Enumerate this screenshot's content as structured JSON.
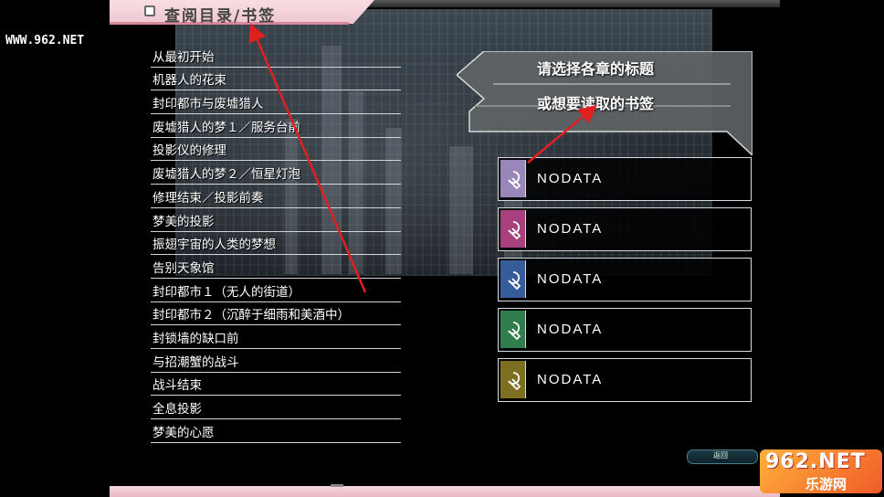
{
  "header": {
    "title": "查阅目录/书签"
  },
  "watermark": {
    "top_left": "WWW.962.NET"
  },
  "chapters": [
    "从最初开始",
    "机器人的花束",
    "封印都市与废墟猎人",
    "废墟猎人的梦１／服务台前",
    "投影仪的修理",
    "废墟猎人的梦２／恒星灯泡",
    "修理结束／投影前奏",
    "梦美的投影",
    "振翅宇宙的人类的梦想",
    "告别天象馆",
    "封印都市１（无人的街道）",
    "封印都市２（沉醉于细雨和美酒中）",
    "封锁墙的缺口前",
    "与招潮蟹的战斗",
    "战斗结束",
    "全息投影",
    "梦美的心愿"
  ],
  "instruction": {
    "line1": "请选择各章的标题",
    "line2": "或想要读取的书签"
  },
  "bookmarks": [
    {
      "label": "NODATA",
      "color": "#9a86b8"
    },
    {
      "label": "NODATA",
      "color": "#a8407e"
    },
    {
      "label": "NODATA",
      "color": "#375c9a"
    },
    {
      "label": "NODATA",
      "color": "#2f7d4c"
    },
    {
      "label": "NODATA",
      "color": "#7d6f22"
    }
  ],
  "icons": {
    "bookmark_slot": "clip-pen-icon",
    "header_marker": "square-icon"
  },
  "return_button": {
    "label": "返回"
  },
  "site_badge": {
    "main": "962.NET",
    "sub": "乐游网"
  },
  "colors": {
    "accent_pink": "#efc7d0",
    "annotation": "#e02020"
  }
}
